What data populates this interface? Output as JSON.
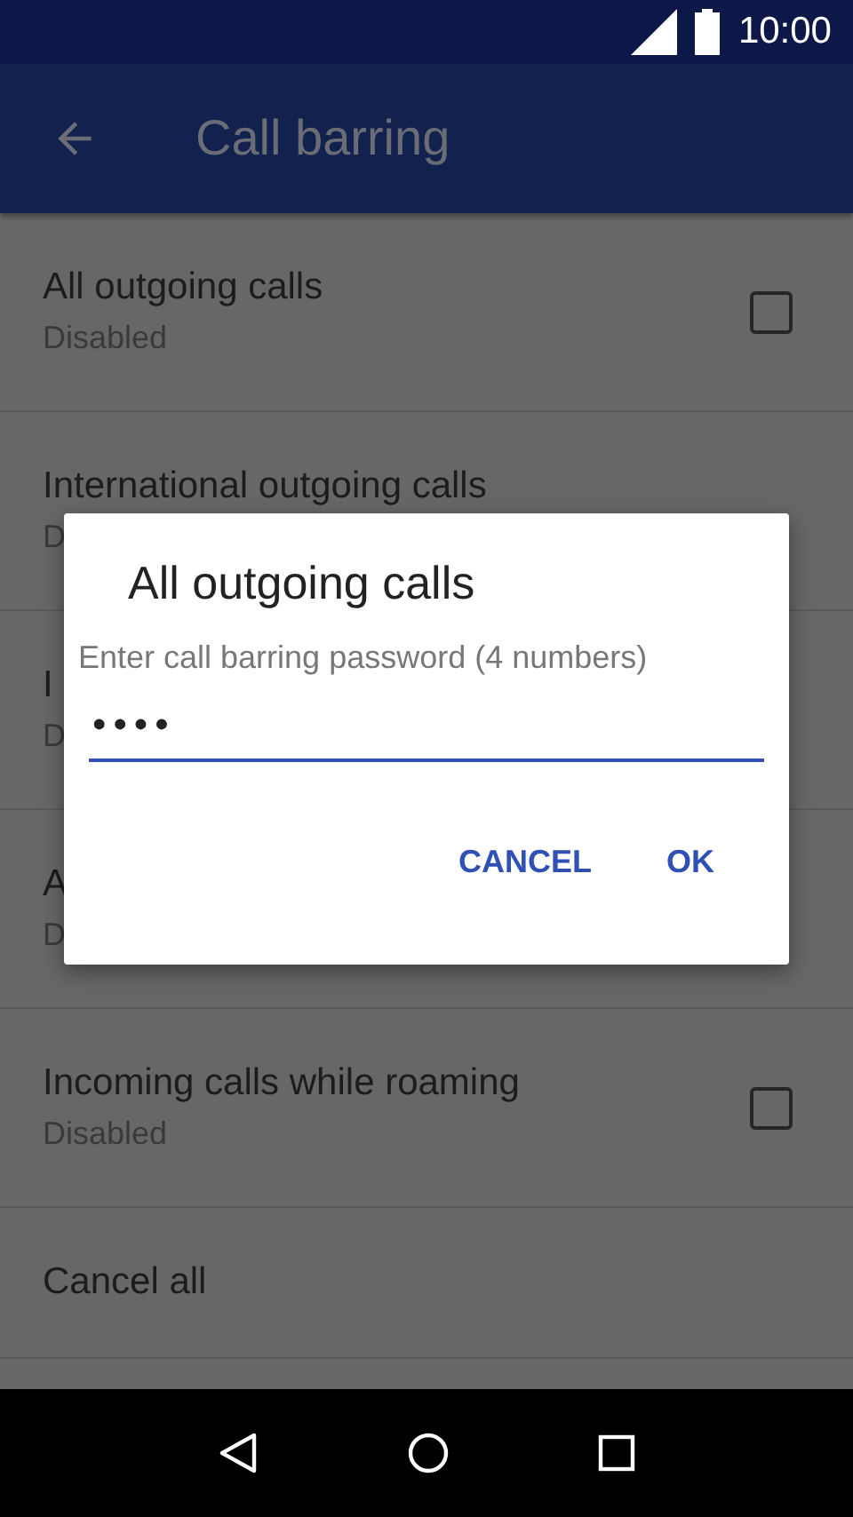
{
  "status_bar": {
    "time": "10:00"
  },
  "app_bar": {
    "title": "Call barring"
  },
  "items": [
    {
      "title": "All outgoing calls",
      "subtitle": "Disabled",
      "checked": false
    },
    {
      "title": "International outgoing calls",
      "subtitle": "D"
    },
    {
      "title": "I",
      "subtitle": "D"
    },
    {
      "title": "A",
      "subtitle": "D"
    },
    {
      "title": "Incoming calls while roaming",
      "subtitle": "Disabled",
      "checked": false
    },
    {
      "title": "Cancel all"
    }
  ],
  "dialog": {
    "title": "All outgoing calls",
    "hint": "Enter call barring password (4 numbers)",
    "value": "••••",
    "buttons": [
      "CANCEL",
      "OK"
    ]
  }
}
